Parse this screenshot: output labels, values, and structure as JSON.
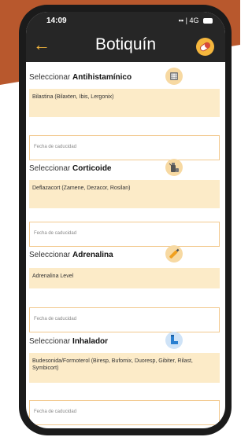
{
  "status": {
    "time": "14:09",
    "network": "4G"
  },
  "header": {
    "title": "Botiquín",
    "back_glyph": "←"
  },
  "sections": [
    {
      "prefix": "Seleccionar",
      "name": "Antihistamínico",
      "drug": "Bilastina (Bilaxten, Ibis, Lergonix)",
      "date_placeholder": "Fecha de caducidad"
    },
    {
      "prefix": "Seleccionar",
      "name": "Corticoide",
      "drug": "Deflazacort (Zamene, Dezacor, Rosilan)",
      "date_placeholder": "Fecha de caducidad"
    },
    {
      "prefix": "Seleccionar",
      "name": "Adrenalina",
      "drug": "Adrenalina Level",
      "date_placeholder": "Fecha de caducidad"
    },
    {
      "prefix": "Seleccionar",
      "name": "Inhalador",
      "drug": "Budesonida/Formoterol (Biresp, Bufomix, Duoresp, Gibiter, Rilast, Symbicort)",
      "date_placeholder": "Fecha de caducidad"
    }
  ],
  "colors": {
    "accent": "#f5b63d",
    "header_bg": "#262626",
    "drug_bg": "#fcebc8",
    "background_shape": "#b8582d"
  }
}
